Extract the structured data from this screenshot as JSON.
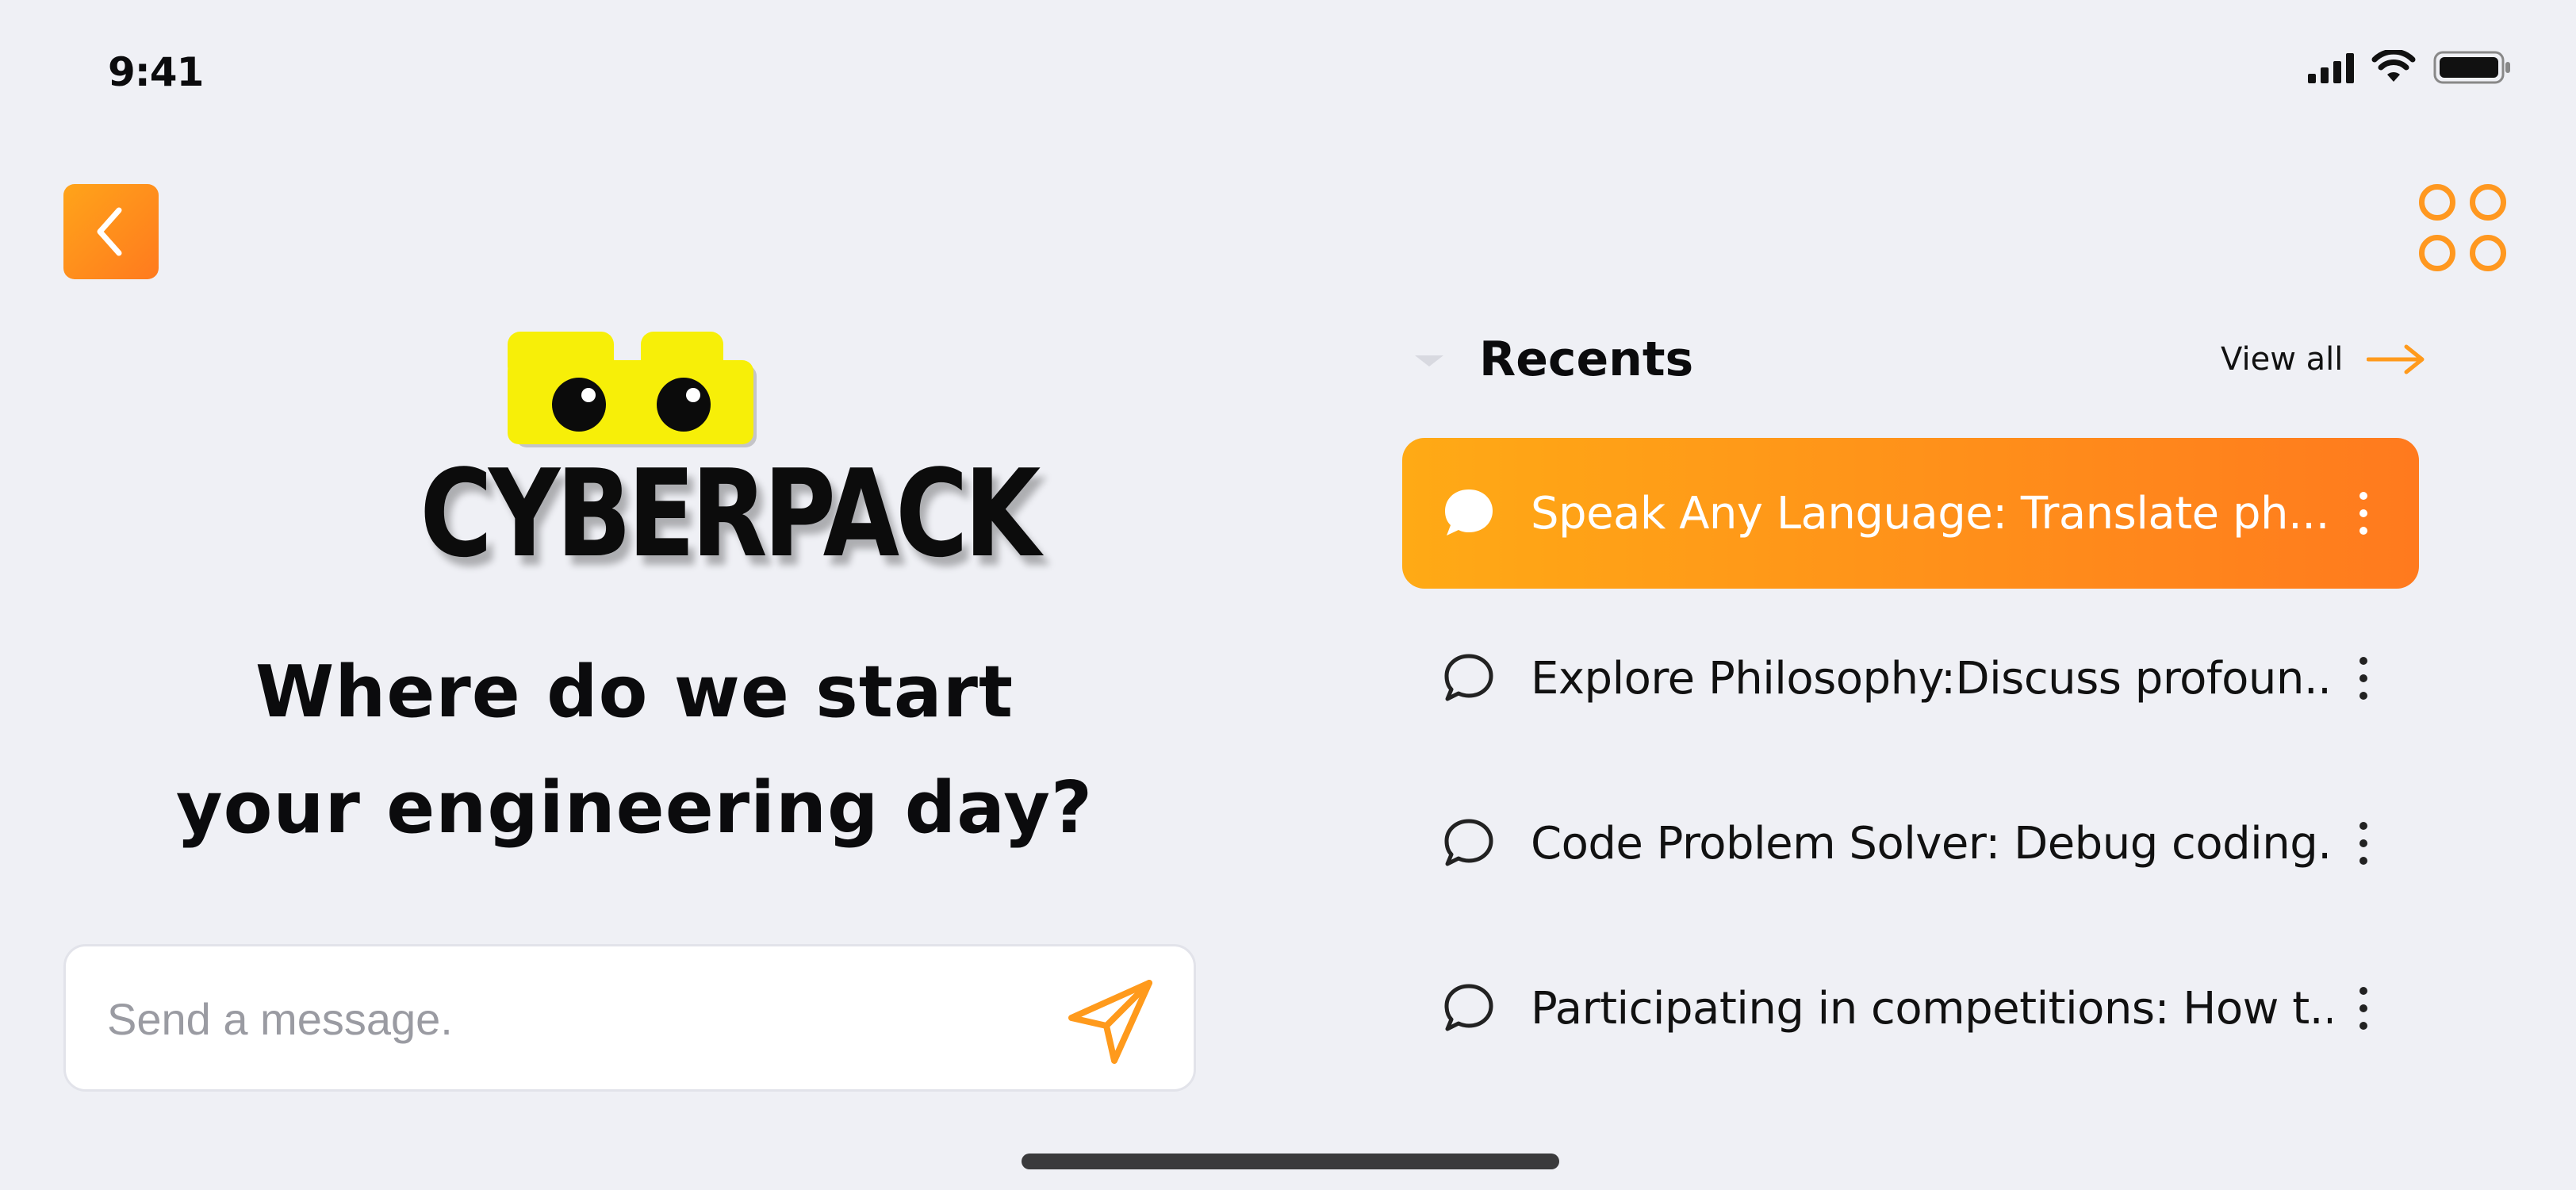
{
  "status_bar": {
    "time": "9:41"
  },
  "brand": {
    "name": "CYBERPACK",
    "mascot_color": "#f7ef08"
  },
  "headline": {
    "line1": "Where do we start",
    "line2": "your engineering day?"
  },
  "message": {
    "placeholder": "Send a message.",
    "value": ""
  },
  "recents": {
    "title": "Recents",
    "view_all_label": "View all",
    "items": [
      {
        "label": "Speak Any Language: Translate ph...",
        "active": true
      },
      {
        "label": "Explore Philosophy:Discuss profoun...",
        "active": false
      },
      {
        "label": "Code Problem Solver: Debug coding...",
        "active": false
      },
      {
        "label": "Participating in competitions: How t...",
        "active": false
      }
    ]
  },
  "colors": {
    "accent_start": "#ffaa15",
    "accent_end": "#ff7a1e",
    "background": "#eff0f5"
  },
  "icons": {
    "back": "chevron-left-icon",
    "menu": "four-circles-icon",
    "send": "paper-plane-icon",
    "view_all": "arrow-right-icon",
    "chat": "chat-bubble-icon",
    "more": "vertical-ellipsis-icon"
  }
}
